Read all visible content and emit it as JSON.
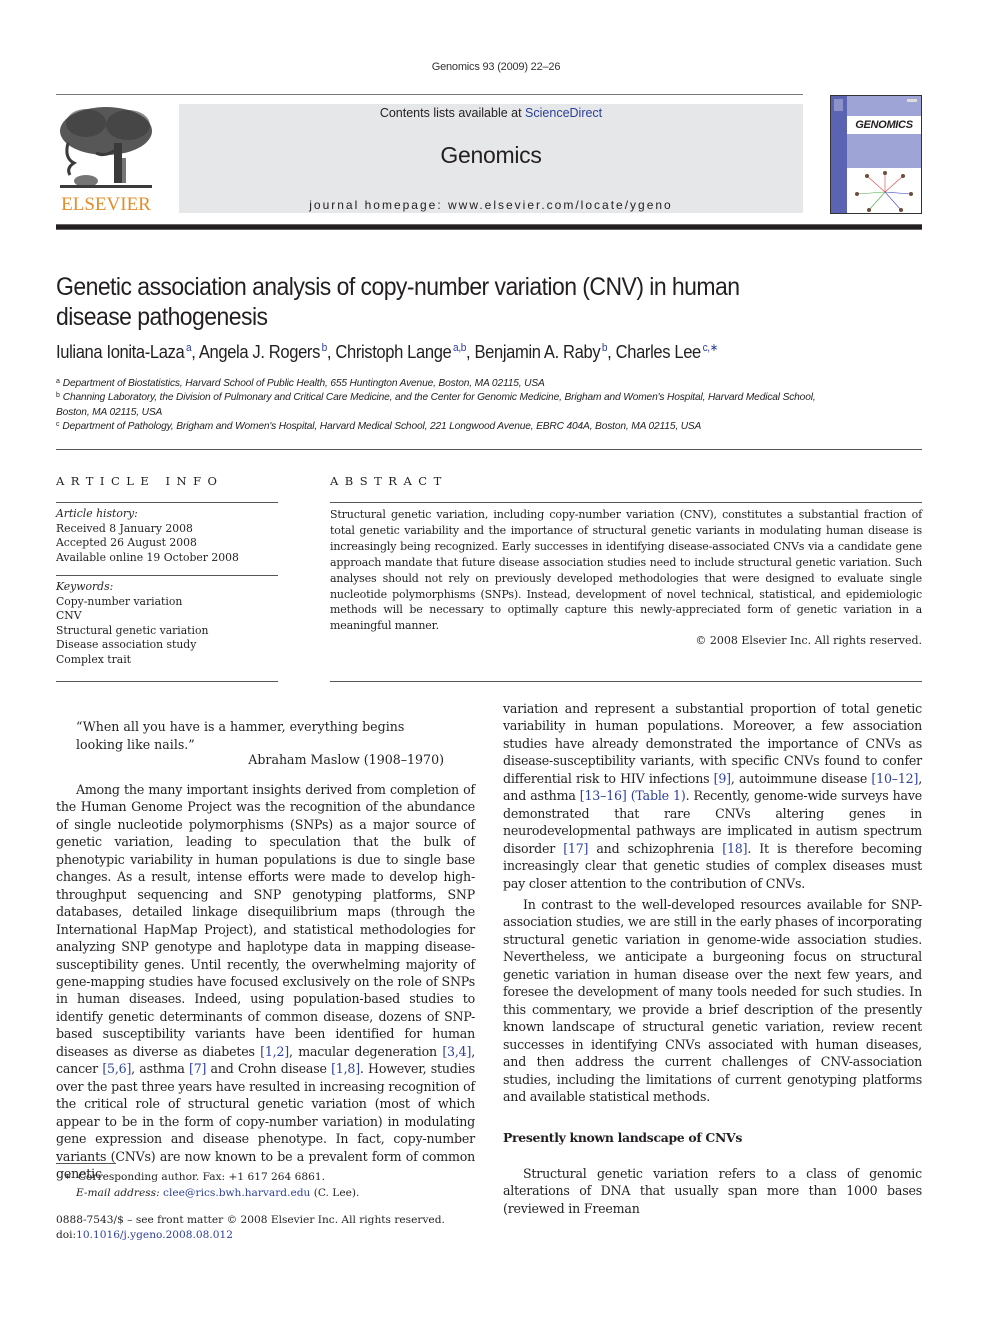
{
  "running_head": "Genomics 93 (2009) 22–26",
  "masthead": {
    "publisher_logo_text": "ELSEVIER",
    "contents_prefix": "Contents lists available at ",
    "contents_link": "ScienceDirect",
    "journal_name": "Genomics",
    "homepage": "journal homepage: www.elsevier.com/locate/ygeno",
    "cover_title": "GENOMICS"
  },
  "article": {
    "title_line1": "Genetic association analysis of copy-number variation (CNV) in human",
    "title_line2": "disease pathogenesis",
    "authors": [
      {
        "name": "Iuliana Ionita-Laza",
        "sup": "a",
        "sep": ", "
      },
      {
        "name": "Angela J. Rogers",
        "sup": "b",
        "sep": ", "
      },
      {
        "name": "Christoph Lange",
        "sup": "a,b",
        "sep": ", "
      },
      {
        "name": "Benjamin A. Raby",
        "sup": "b",
        "sep": ", "
      },
      {
        "name": "Charles Lee",
        "sup": "c,∗",
        "sep": ""
      }
    ],
    "affiliations": [
      {
        "key": "a",
        "text": "Department of Biostatistics, Harvard School of Public Health, 655 Huntington Avenue, Boston, MA 02115, USA"
      },
      {
        "key": "b",
        "text": "Channing Laboratory, the Division of Pulmonary and Critical Care Medicine, and the Center for Genomic Medicine, Brigham and Women's Hospital, Harvard Medical School,",
        "text_cont": "Boston, MA 02115, USA"
      },
      {
        "key": "c",
        "text": "Department of Pathology, Brigham and Women's Hospital, Harvard Medical School, 221 Longwood Avenue, EBRC 404A, Boston, MA 02115, USA"
      }
    ]
  },
  "article_info": {
    "label": "ARTICLE INFO",
    "history_label": "Article history:",
    "history": [
      "Received 8 January 2008",
      "Accepted 26 August 2008",
      "Available online 19 October 2008"
    ],
    "keywords_label": "Keywords:",
    "keywords": [
      "Copy-number variation",
      "CNV",
      "Structural genetic variation",
      "Disease association study",
      "Complex trait"
    ]
  },
  "abstract": {
    "label": "ABSTRACT",
    "text": "Structural genetic variation, including copy-number variation (CNV), constitutes a substantial fraction of total genetic variability and the importance of structural genetic variants in modulating human disease is increasingly being recognized. Early successes in identifying disease-associated CNVs via a candidate gene approach mandate that future disease association studies need to include structural genetic variation. Such analyses should not rely on previously developed methodologies that were designed to evaluate single nucleotide polymorphisms (SNPs). Instead, development of novel technical, statistical, and epidemiologic methods will be necessary to optimally capture this newly-appreciated form of genetic variation in a meaningful manner.",
    "copyright": "© 2008 Elsevier Inc. All rights reserved."
  },
  "body": {
    "epigraph_quote": "“When all you have is a hammer, everything begins looking like nails.”",
    "epigraph_attribution": "Abraham Maslow (1908–1970)",
    "col1_para": [
      {
        "t": "Among the many important insights derived from completion of the Human Genome Project was the recognition of the abundance of single nucleotide polymorphisms (SNPs) as a major source of genetic variation, leading to speculation that the bulk of phenotypic variability in human populations is due to single base changes. As a result, intense efforts were made to develop high-throughput sequencing and SNP genotyping platforms, SNP databases, detailed linkage disequilibrium maps (through the International HapMap Project), and statistical methodologies for analyzing SNP genotype and haplotype data in mapping disease-susceptibility genes. Until recently, the overwhelming majority of gene-mapping studies have focused exclusively on the role of SNPs in human diseases. Indeed, using population-based studies to identify genetic determinants of common disease, dozens of SNP-based susceptibility variants have been identified for human diseases as diverse as diabetes "
      },
      {
        "ref": "[1,2]"
      },
      {
        "t": ", macular degeneration "
      },
      {
        "ref": "[3,4]"
      },
      {
        "t": ", cancer "
      },
      {
        "ref": "[5,6]"
      },
      {
        "t": ", asthma "
      },
      {
        "ref": "[7]"
      },
      {
        "t": " and Crohn disease "
      },
      {
        "ref": "[1,8]"
      },
      {
        "t": ". However, studies over the past three years have resulted in increasing recognition of the critical role of structural genetic variation (most of which appear to be in the form of copy-number variation) in modulating gene expression and disease phenotype. In fact, copy-number variants (CNVs) are now known to be a prevalent form of common genetic"
      }
    ],
    "col2_para1": [
      {
        "t": "variation and represent a substantial proportion of total genetic variability in human populations. Moreover, a few association studies have already demonstrated the importance of CNVs as disease-susceptibility variants, with specific CNVs found to confer differential risk to HIV infections "
      },
      {
        "ref": "[9]"
      },
      {
        "t": ", autoimmune disease "
      },
      {
        "ref": "[10–12]"
      },
      {
        "t": ", and asthma "
      },
      {
        "ref": "[13–16]"
      },
      {
        "t": " "
      },
      {
        "ref": "(Table 1)"
      },
      {
        "t": ". Recently, genome-wide surveys have demonstrated that rare CNVs altering genes in neurodevelopmental pathways are implicated in autism spectrum disorder "
      },
      {
        "ref": "[17]"
      },
      {
        "t": " and schizophrenia "
      },
      {
        "ref": "[18]"
      },
      {
        "t": ". It is therefore becoming increasingly clear that genetic studies of complex diseases must pay closer attention to the contribution of CNVs."
      }
    ],
    "col2_para2": "In contrast to the well-developed resources available for SNP-association studies, we are still in the early phases of incorporating structural genetic variation in genome-wide association studies. Nevertheless, we anticipate a burgeoning focus on structural genetic variation in human disease over the next few years, and foresee the development of many tools needed for such studies. In this commentary, we provide a brief description of the presently known landscape of structural genetic variation, review recent successes in identifying CNVs associated with human diseases, and then address the current challenges of CNV-association studies, including the limitations of current genotyping platforms and available statistical methods.",
    "section_heading": "Presently known landscape of CNVs",
    "col2_para3": "Structural genetic variation refers to a class of genomic alterations of DNA that usually span more than 1000 bases (reviewed in Freeman"
  },
  "footnote": {
    "marker": "∗",
    "corresponding": "Corresponding author. Fax: +1 617 264 6861.",
    "email_label": "E-mail address:",
    "email": "clee@rics.bwh.harvard.edu",
    "email_suffix": " (C. Lee)."
  },
  "front_matter": {
    "issn_line": "0888-7543/$ – see front matter © 2008 Elsevier Inc. All rights reserved.",
    "doi_prefix": "doi:",
    "doi": "10.1016/j.ygeno.2008.08.012"
  },
  "colors": {
    "link": "#2c3f9a",
    "elsevier_orange": "#e28e2a",
    "masthead_gray": "#e6e7e8",
    "cover_blue": "#5a64b2"
  }
}
